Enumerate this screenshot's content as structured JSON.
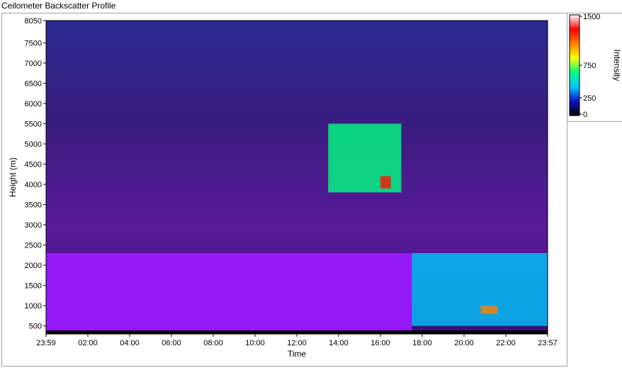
{
  "window": {
    "title": "Ceilometer Backscatter Profile"
  },
  "chart_data": {
    "type": "heatmap",
    "title": "Ceilometer Backscatter Profile",
    "xlabel": "Time",
    "ylabel": "Height (m)",
    "x_ticks": [
      "23:59",
      "02:00",
      "04:00",
      "06:00",
      "08:00",
      "10:00",
      "12:00",
      "14:00",
      "16:00",
      "18:00",
      "20:00",
      "22:00",
      "23:57"
    ],
    "y_ticks": [
      500,
      1000,
      1500,
      2000,
      2500,
      3000,
      3500,
      4000,
      4500,
      5000,
      5500,
      6000,
      6500,
      7000,
      7500,
      8050
    ],
    "ylim": [
      300,
      8050
    ],
    "colorbar": {
      "label": "Intensity",
      "ticks": [
        0,
        250,
        750,
        1500
      ],
      "range": [
        0,
        1500
      ],
      "colors": [
        "#000000",
        "#1010c8",
        "#00c8ff",
        "#00ff80",
        "#ffff00",
        "#ff8000",
        "#ff0000",
        "#ffffff"
      ]
    },
    "grid": false,
    "background_color": "#5a1a9a",
    "low_cloud_color": "#9a1aff",
    "features": [
      {
        "type": "low_backscatter_layer",
        "start_hour": 0,
        "end_hour": 17.5,
        "top_m": 2300,
        "intensity": 0
      },
      {
        "type": "cloud_layer",
        "start_hour": 13.5,
        "end_hour": 17.0,
        "base_m": 3800,
        "top_m": 5500,
        "intensity": 700
      },
      {
        "type": "cloud_layer",
        "start_hour": 16.0,
        "end_hour": 16.5,
        "base_m": 3900,
        "top_m": 4200,
        "intensity": 1500
      },
      {
        "type": "cloud_layer",
        "start_hour": 17.5,
        "end_hour": 24.0,
        "base_m": 500,
        "top_m": 2300,
        "intensity": 400
      },
      {
        "type": "cloud_layer",
        "start_hour": 20.8,
        "end_hour": 21.6,
        "base_m": 800,
        "top_m": 1000,
        "intensity": 1200
      }
    ]
  }
}
